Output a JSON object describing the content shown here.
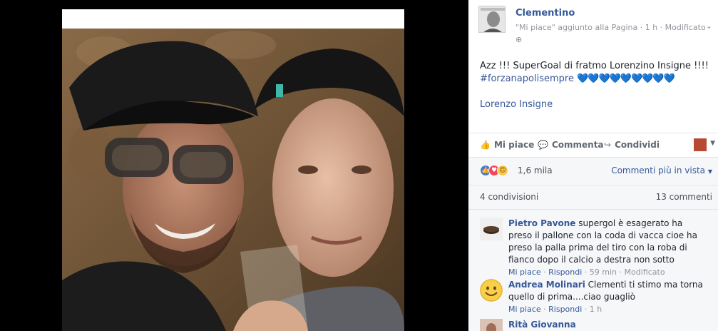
{
  "post": {
    "page_name": "Clementino",
    "meta": "\"Mi piace\" aggiunto alla Pagina · 1 h · Modificato ·",
    "globe_icon": "globe-icon",
    "text": "Azz !!! SuperGoal di fratmo Lorenzino Insigne !!!!",
    "hashtag": "#forzanapolisempre",
    "hearts": "💙💙💙💙💙💙💙💙💙",
    "mention": "Lorenzo Insigne"
  },
  "actions": {
    "like": "Mi piace",
    "comment": "Commenta",
    "share": "Condividi"
  },
  "stats": {
    "reactions_count": "1,6 mila",
    "sort_label": "Commenti più in vista",
    "shares": "4 condivisioni",
    "comments": "13 commenti"
  },
  "comments": [
    {
      "author": "Pietro Pavone",
      "text": "supergol è esagerato ha preso il pallone con la coda di vacca cioe ha preso la palla prima del tiro con la roba di fianco dopo il calcio a destra non sotto",
      "like": "Mi piace",
      "reply": "Rispondi",
      "time": "59 min",
      "edited": "Modificato"
    },
    {
      "author": "Andrea Molinari",
      "text": "Clementi ti stimo ma torna quello di prima....ciao guagliò",
      "like": "Mi piace",
      "reply": "Rispondi",
      "time": "1 h"
    },
    {
      "author": "Rità Giovanna",
      "text": ""
    }
  ],
  "colors": {
    "link": "#365899",
    "muted": "#90949c",
    "heart": "#3b8ee8"
  }
}
